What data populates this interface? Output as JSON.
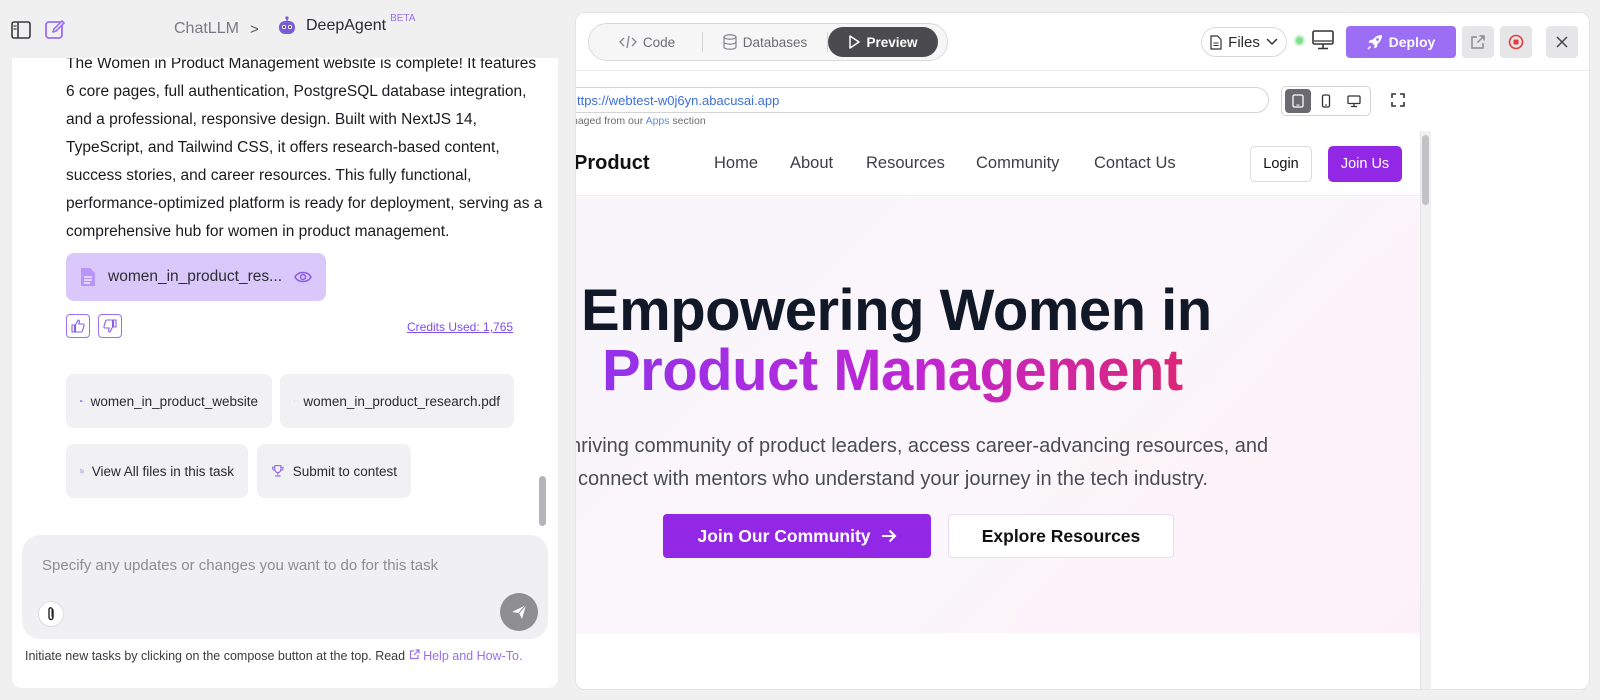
{
  "header": {
    "breadcrumb_app": "ChatLLM",
    "breadcrumb_sep": ">",
    "agent_name": "DeepAgent",
    "agent_badge": "BETA"
  },
  "chat": {
    "message": "The Women in Product Management website is complete! It features 6 core pages, full authentication, PostgreSQL database integration, and a professional, responsive design. Built with NextJS 14, TypeScript, and Tailwind CSS, it offers research-based content, success stories, and career resources. This fully functional, performance-optimized platform is ready for deployment, serving as a comprehensive hub for women in product management.",
    "file_chip": "women_in_product_res...",
    "credits": "Credits Used: 1,765",
    "pills": {
      "folder": "women_in_product_website",
      "pdf": "women_in_product_research.pdf",
      "view_all": "View All files in this task",
      "contest": "Submit to contest"
    },
    "composer_placeholder": "Specify any updates or changes you want to do for this task",
    "footer_text": "Initiate new tasks by clicking on the compose button at the top. Read",
    "footer_link": "Help and How-To."
  },
  "preview": {
    "tabs": [
      {
        "label": "Code",
        "icon": "code-icon"
      },
      {
        "label": "Databases",
        "icon": "database-icon"
      },
      {
        "label": "Preview",
        "icon": "play-icon",
        "active": true
      }
    ],
    "files_label": "Files",
    "deploy_label": "Deploy",
    "url": "ttps://webtest-w0j6yn.abacusai.app",
    "url_note_prefix": "naged from our",
    "url_note_link": "Apps",
    "url_note_suffix": "section",
    "accent": "#9b6ef3"
  },
  "site": {
    "brand": "Product",
    "nav": [
      "Home",
      "About",
      "Resources",
      "Community",
      "Contact Us"
    ],
    "login": "Login",
    "join": "Join Us",
    "hero_line1": "Empowering Women in",
    "hero_line2": "Product Management",
    "sub_line1": "hriving community of product leaders, access career-advancing resources, and",
    "sub_line2": "connect with mentors who understand your journey in the tech industry.",
    "cta_primary": "Join Our Community",
    "cta_secondary": "Explore Resources",
    "accent": "#9327e6"
  }
}
